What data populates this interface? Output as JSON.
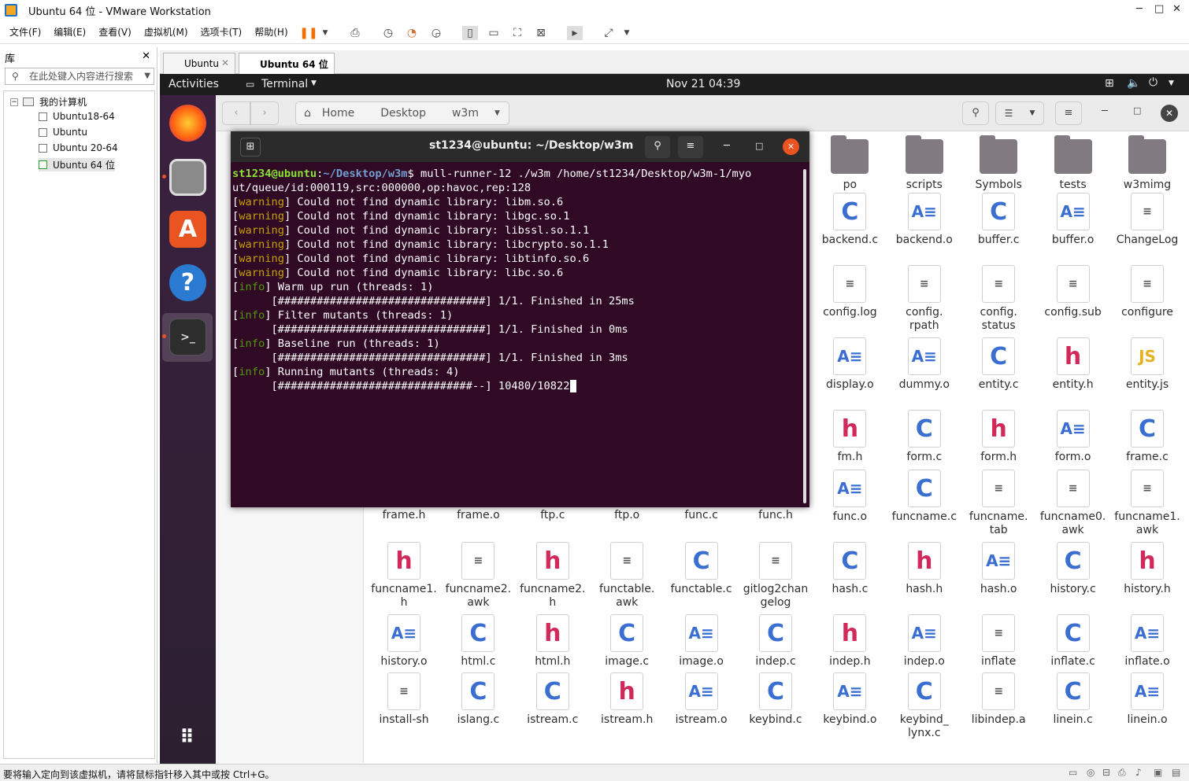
{
  "window": {
    "title": "Ubuntu 64 位 - VMware Workstation"
  },
  "menu": [
    "文件(F)",
    "编辑(E)",
    "查看(V)",
    "虚拟机(M)",
    "选项卡(T)",
    "帮助(H)"
  ],
  "library": {
    "header": "库",
    "search_placeholder": "在此处键入内容进行搜索",
    "root": "我的计算机",
    "items": [
      "Ubuntu18-64",
      "Ubuntu",
      "Ubuntu 20-64",
      "Ubuntu 64 位"
    ]
  },
  "tabs": [
    {
      "label": "Ubuntu"
    },
    {
      "label": "Ubuntu 64 位"
    }
  ],
  "topbar": {
    "activities": "Activities",
    "app": "Terminal",
    "clock": "Nov 21  04:39"
  },
  "nautilus": {
    "path": [
      "Home",
      "Desktop",
      "w3m"
    ]
  },
  "terminal": {
    "title": "st1234@ubuntu: ~/Desktop/w3m",
    "prompt_user": "st1234@ubuntu",
    "prompt_path": "~/Desktop/w3m",
    "command": "mull-runner-12 ./w3m /home/st1234/Desktop/w3m-1/myo",
    "command_cont": "ut/queue/id:000119,src:000000,op:havoc,rep:128",
    "warnings": [
      "Could not find dynamic library: libm.so.6",
      "Could not find dynamic library: libgc.so.1",
      "Could not find dynamic library: libssl.so.1.1",
      "Could not find dynamic library: libcrypto.so.1.1",
      "Could not find dynamic library: libtinfo.so.6",
      "Could not find dynamic library: libc.so.6"
    ],
    "warning_tag": "warning",
    "info_tag": "info",
    "steps": [
      {
        "info": "Warm up run (threads: 1)",
        "bar": "      [################################] 1/1. Finished in 25ms"
      },
      {
        "info": "Filter mutants (threads: 1)",
        "bar": "      [################################] 1/1. Finished in 0ms"
      },
      {
        "info": "Baseline run (threads: 1)",
        "bar": "      [################################] 1/1. Finished in 3ms"
      },
      {
        "info": "Running mutants (threads: 4)",
        "bar": "      [##############################--] 10480/10822"
      }
    ]
  },
  "files": [
    [
      "po",
      "folder"
    ],
    [
      "scripts",
      "folder"
    ],
    [
      "Symbols",
      "folder"
    ],
    [
      "tests",
      "folder"
    ],
    [
      "w3mimg",
      "folder"
    ],
    [
      "backend.c",
      "c"
    ],
    [
      "backend.o",
      "a"
    ],
    [
      "buffer.c",
      "c"
    ],
    [
      "buffer.o",
      "a"
    ],
    [
      "ChangeLog",
      "t"
    ],
    [
      "config.log",
      "t"
    ],
    [
      "config.\nrpath",
      "t"
    ],
    [
      "config.\nstatus",
      "t"
    ],
    [
      "config.sub",
      "t"
    ],
    [
      "configure",
      "t"
    ],
    [
      "display.o",
      "a"
    ],
    [
      "dummy.o",
      "a"
    ],
    [
      "entity.c",
      "c"
    ],
    [
      "entity.h",
      "h"
    ],
    [
      "entity.js",
      "js"
    ],
    [
      "fm.h",
      "h"
    ],
    [
      "form.c",
      "c"
    ],
    [
      "form.h",
      "h"
    ],
    [
      "form.o",
      "a"
    ],
    [
      "frame.c",
      "c"
    ],
    [
      "func.o",
      "a"
    ],
    [
      "funcname.c",
      "c"
    ],
    [
      "funcname.\ntab",
      "t"
    ],
    [
      "funcname0.\nawk",
      "t"
    ],
    [
      "funcname1.\nawk",
      "t"
    ]
  ],
  "files_behind": [
    "frame.h",
    "frame.o",
    "ftp.c",
    "ftp.o",
    "func.c",
    "func.h"
  ],
  "files_rows": [
    [
      [
        "funcname1.\nh",
        "h"
      ],
      [
        "funcname2.\nawk",
        "t"
      ],
      [
        "funcname2.\nh",
        "h"
      ],
      [
        "functable.\nawk",
        "t"
      ],
      [
        "functable.c",
        "c"
      ],
      [
        "gitlog2chan\ngelog",
        "t"
      ],
      [
        "hash.c",
        "c"
      ],
      [
        "hash.h",
        "h"
      ],
      [
        "hash.o",
        "a"
      ],
      [
        "history.c",
        "c"
      ],
      [
        "history.h",
        "h"
      ]
    ],
    [
      [
        "history.o",
        "a"
      ],
      [
        "html.c",
        "c"
      ],
      [
        "html.h",
        "h"
      ],
      [
        "image.c",
        "c"
      ],
      [
        "image.o",
        "a"
      ],
      [
        "indep.c",
        "c"
      ],
      [
        "indep.h",
        "h"
      ],
      [
        "indep.o",
        "a"
      ],
      [
        "inflate",
        "t"
      ],
      [
        "inflate.c",
        "c"
      ],
      [
        "inflate.o",
        "a"
      ]
    ],
    [
      [
        "install-sh",
        "t"
      ],
      [
        "islang.c",
        "c"
      ],
      [
        "istream.c",
        "c"
      ],
      [
        "istream.h",
        "h"
      ],
      [
        "istream.o",
        "a"
      ],
      [
        "keybind.c",
        "c"
      ],
      [
        "keybind.o",
        "a"
      ],
      [
        "keybind_\nlynx.c",
        "c"
      ],
      [
        "libindep.a",
        "t"
      ],
      [
        "linein.c",
        "c"
      ],
      [
        "linein.o",
        "a"
      ]
    ]
  ],
  "status": {
    "text": "要将输入定向到该虚拟机，请将鼠标指针移入其中或按 Ctrl+G。"
  }
}
